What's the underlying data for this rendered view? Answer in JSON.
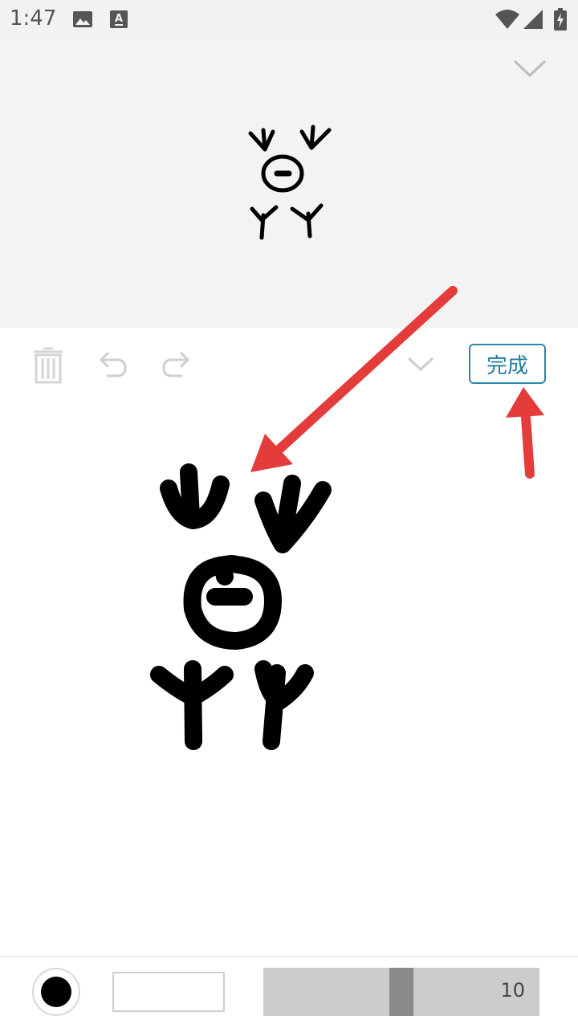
{
  "status_bar": {
    "time": "1:47",
    "left_icons": [
      "image-icon",
      "text-a-icon"
    ],
    "right_icons": [
      "wifi-icon",
      "cell-signal-icon",
      "battery-charging-icon"
    ]
  },
  "preview": {
    "collapse_icon": "chevron-down-icon"
  },
  "toolbar": {
    "delete_icon": "trash-icon",
    "undo_icon": "undo-icon",
    "redo_icon": "redo-icon",
    "collapse_icon": "chevron-down-icon",
    "done_label": "完成"
  },
  "bottom_bar": {
    "pen_color": "#000000",
    "stroke_width": "10",
    "stroke_width_fraction": 0.5
  },
  "annotations": {
    "arrow_color": "#e43b3b"
  }
}
